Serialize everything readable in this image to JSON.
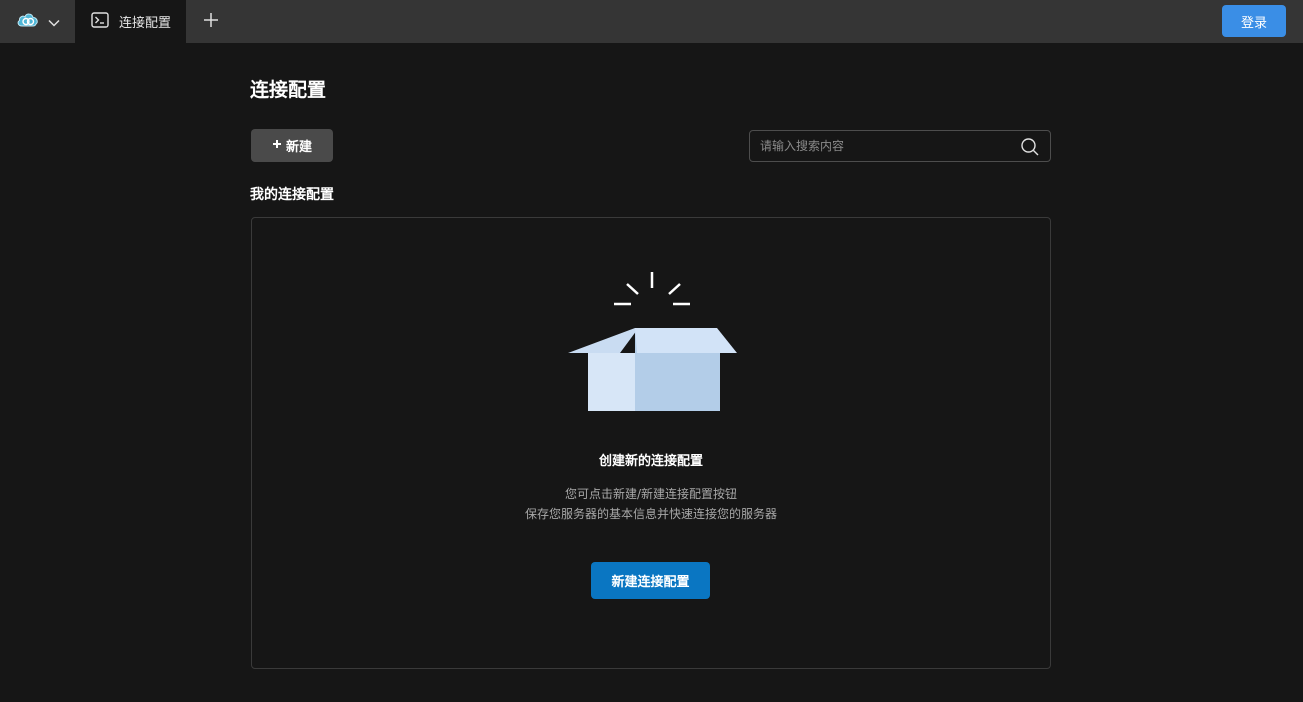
{
  "topbar": {
    "logo_icon": "cloud-logo-icon",
    "dropdown_icon": "chevron-down-icon",
    "tab": {
      "icon": "terminal-icon",
      "label": "连接配置"
    },
    "add_tab_icon": "plus-icon",
    "login_label": "登录"
  },
  "page": {
    "title": "连接配置",
    "new_button": {
      "icon": "plus-icon",
      "label": "新建"
    },
    "search": {
      "placeholder": "请输入搜索内容",
      "value": ""
    },
    "section_title": "我的连接配置"
  },
  "empty_state": {
    "illustration": "open-box-icon",
    "title": "创建新的连接配置",
    "desc_line1": "您可点击新建/新建连接配置按钮",
    "desc_line2": "保存您服务器的基本信息并快速连接您的服务器",
    "button_label": "新建连接配置"
  },
  "colors": {
    "accent": "#3a8ee6",
    "primary_button": "#0a76c2",
    "background": "#161616",
    "topbar": "#353535"
  }
}
